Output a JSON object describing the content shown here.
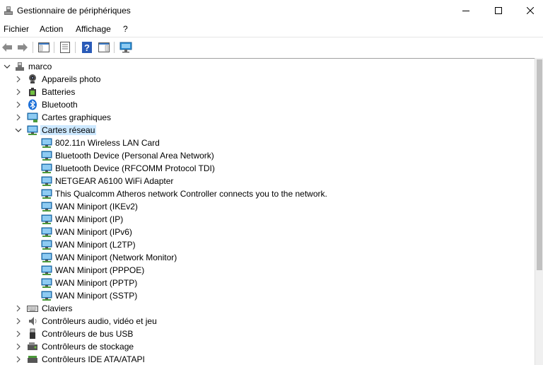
{
  "window": {
    "title": "Gestionnaire de périphériques"
  },
  "menu": [
    "Fichier",
    "Action",
    "Affichage",
    "?"
  ],
  "toolbar": {
    "buttons": [
      "back-icon",
      "forward-icon",
      "console-tree-icon",
      "properties-icon",
      "help-icon",
      "action-pane-icon",
      "monitor-icon"
    ]
  },
  "tree": {
    "root": "marco",
    "categories_before": [
      {
        "label": "Appareils photo",
        "icon": "camera-icon"
      },
      {
        "label": "Batteries",
        "icon": "battery-icon"
      },
      {
        "label": "Bluetooth",
        "icon": "bluetooth-icon"
      },
      {
        "label": "Cartes graphiques",
        "icon": "display-adapter-icon"
      }
    ],
    "expanded": {
      "label": "Cartes réseau",
      "icon": "network-adapter-icon"
    },
    "network_devices": [
      "802.11n Wireless LAN Card",
      "Bluetooth Device (Personal Area Network)",
      "Bluetooth Device (RFCOMM Protocol TDI)",
      "NETGEAR A6100 WiFi Adapter",
      "This Qualcomm Atheros network Controller connects you to the network.",
      "WAN Miniport (IKEv2)",
      "WAN Miniport (IP)",
      "WAN Miniport (IPv6)",
      "WAN Miniport (L2TP)",
      "WAN Miniport (Network Monitor)",
      "WAN Miniport (PPPOE)",
      "WAN Miniport (PPTP)",
      "WAN Miniport (SSTP)"
    ],
    "categories_after": [
      {
        "label": "Claviers",
        "icon": "keyboard-icon"
      },
      {
        "label": "Contrôleurs audio, vidéo et jeu",
        "icon": "speaker-icon"
      },
      {
        "label": "Contrôleurs de bus USB",
        "icon": "usb-icon"
      },
      {
        "label": "Contrôleurs de stockage",
        "icon": "storage-controller-icon"
      },
      {
        "label": "Contrôleurs IDE ATA/ATAPI",
        "icon": "ide-controller-icon"
      }
    ]
  },
  "colors": {
    "selection": "#cce8ff",
    "network_icon": "#2b8fd6",
    "bluetooth": "#1b6fd8"
  }
}
